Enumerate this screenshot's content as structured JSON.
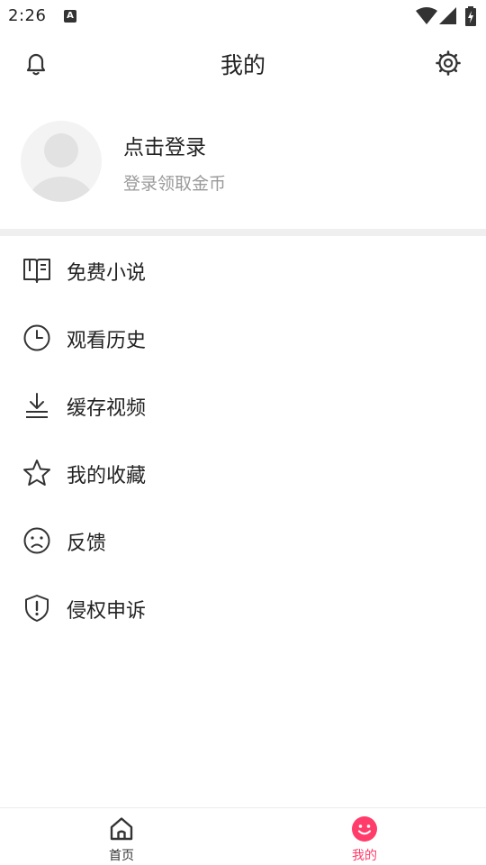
{
  "status_bar": {
    "time": "2:26",
    "notification_glyph": "A"
  },
  "header": {
    "title": "我的",
    "left_icon": "bell-icon",
    "right_icon": "gear-icon"
  },
  "profile": {
    "login_title": "点击登录",
    "login_subtitle": "登录领取金币"
  },
  "menu": {
    "items": [
      {
        "label": "免费小说",
        "icon": "book-icon"
      },
      {
        "label": "观看历史",
        "icon": "clock-icon"
      },
      {
        "label": "缓存视频",
        "icon": "download-icon"
      },
      {
        "label": "我的收藏",
        "icon": "star-icon"
      },
      {
        "label": "反馈",
        "icon": "sad-face-icon"
      },
      {
        "label": "侵权申诉",
        "icon": "shield-alert-icon"
      }
    ]
  },
  "bottom_nav": {
    "home_label": "首页",
    "mine_label": "我的",
    "active_tab": "我的"
  },
  "colors": {
    "accent": "#ff3c6a",
    "text_primary": "#222222",
    "text_secondary": "#9a9a9a",
    "divider": "#efefef"
  }
}
